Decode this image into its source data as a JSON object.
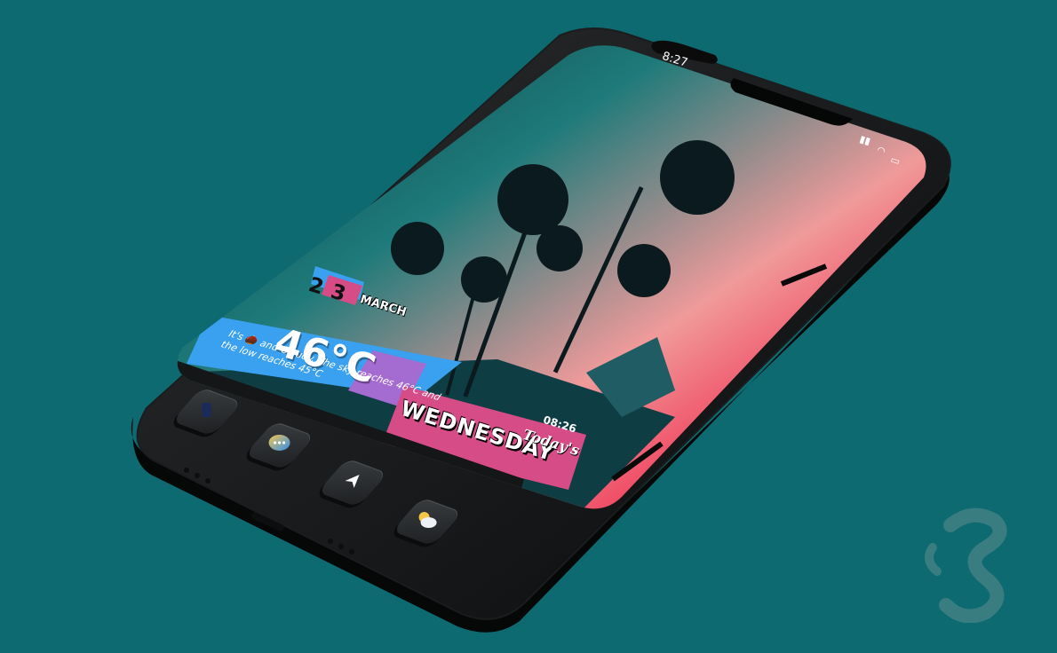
{
  "status_bar": {
    "time": "8:27"
  },
  "widget": {
    "date_number": "2 3",
    "month": "MARCH",
    "temperature": "46°C",
    "description": "It's 🌰 and Cloudy. The sky reaches 46°C and the low reaches 45°C",
    "weekday": "WEDNESDAY",
    "todays_label": "Today's",
    "clock": "08:26"
  },
  "dock": {
    "icons": [
      "phone-icon",
      "messages-icon",
      "maps-icon",
      "weather-icon"
    ]
  },
  "colors": {
    "background": "#0d6a70",
    "widget_blue": "#3aa0f0",
    "widget_pink": "#d64c86",
    "widget_purple": "#a46bd0"
  }
}
